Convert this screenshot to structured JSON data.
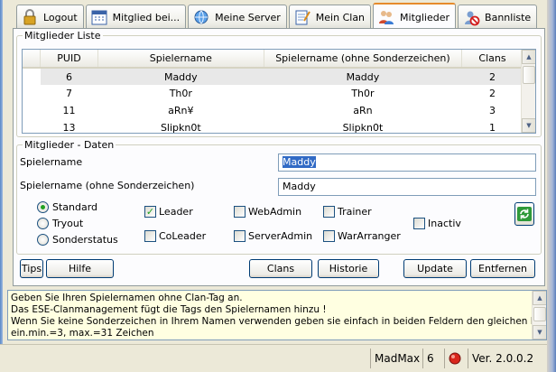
{
  "tabs": [
    {
      "label": "Logout",
      "icon": "lock-icon"
    },
    {
      "label": "Mitglied bei...",
      "icon": "calendar-icon"
    },
    {
      "label": "Meine Server",
      "icon": "server-icon"
    },
    {
      "label": "Mein Clan",
      "icon": "notepad-icon"
    },
    {
      "label": "Mitglieder",
      "icon": "users-icon",
      "active": true
    },
    {
      "label": "Bannliste",
      "icon": "ban-icon"
    }
  ],
  "list": {
    "legend": "Mitglieder Liste",
    "columns": [
      "PUID",
      "Spielername",
      "Spielername (ohne Sonderzeichen)",
      "Clans"
    ],
    "rows": [
      {
        "puid": "6",
        "name": "Maddy",
        "plain": "Maddy",
        "clans": "2"
      },
      {
        "puid": "7",
        "name": "Th0r",
        "plain": "Th0r",
        "clans": "2"
      },
      {
        "puid": "11",
        "name": "aRn¥",
        "plain": "aRn",
        "clans": "3"
      },
      {
        "puid": "13",
        "name": "Slipkn0t",
        "plain": "Slipkn0t",
        "clans": "1"
      }
    ]
  },
  "details": {
    "legend": "Mitglieder - Daten",
    "name_label": "Spielername",
    "name_value": "Maddy",
    "plain_label": "Spielername (ohne Sonderzeichen)",
    "plain_value": "Maddy"
  },
  "radios": [
    {
      "label": "Standard",
      "checked": true
    },
    {
      "label": "Tryout",
      "checked": false
    },
    {
      "label": "Sonderstatus",
      "checked": false
    }
  ],
  "checks": {
    "leader": {
      "label": "Leader",
      "checked": true
    },
    "webadmin": {
      "label": "WebAdmin",
      "checked": false
    },
    "trainer": {
      "label": "Trainer",
      "checked": false
    },
    "inactiv": {
      "label": "Inactiv",
      "checked": false
    },
    "coleader": {
      "label": "CoLeader",
      "checked": false
    },
    "serveradmin": {
      "label": "ServerAdmin",
      "checked": false
    },
    "wararranger": {
      "label": "WarArranger",
      "checked": false
    }
  },
  "buttons": {
    "tips": "Tips",
    "hilfe": "Hilfe",
    "clans": "Clans",
    "historie": "Historie",
    "update": "Update",
    "entfernen": "Entfernen"
  },
  "info": [
    "Geben Sie Ihren Spielernamen ohne Clan-Tag an.",
    "Das ESE-Clanmanagement fügt die Tags den Spielernamen hinzu !",
    "Wenn Sie keine Sonderzeichen in Ihrem Namen verwenden geben sie einfach in beiden Feldern den gleichen Namen",
    "ein.min.=3, max.=31 Zeichen"
  ],
  "status": {
    "user": "MadMax",
    "count": "6",
    "version": "Ver. 2.0.0.2"
  },
  "colors": {
    "tab_accent": "#e68b2c",
    "selection": "#316ac5",
    "status_light": "#d9261c",
    "info_bg": "#ffffe1"
  }
}
